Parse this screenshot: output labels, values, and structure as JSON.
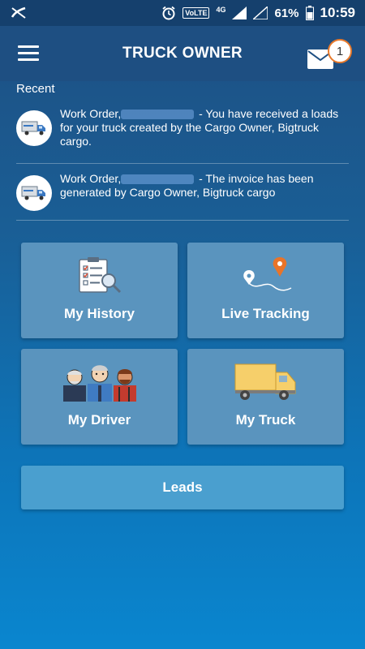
{
  "status_bar": {
    "volte": "VoLTE",
    "network": "4G",
    "battery": "61%",
    "time": "10:59"
  },
  "appbar": {
    "title": "TRUCK OWNER",
    "mail_badge_count": "1"
  },
  "recent": {
    "label": "Recent",
    "items": [
      {
        "prefix": "Work Order,",
        "text": " - You have received a loads for your truck created by the Cargo Owner, Bigtruck cargo."
      },
      {
        "prefix": "Work Order,",
        "text": " - The invoice has been generated by Cargo Owner, Bigtruck cargo"
      }
    ]
  },
  "tiles": [
    {
      "label": "My History",
      "icon": "clipboard-search-icon"
    },
    {
      "label": "Live Tracking",
      "icon": "location-route-icon"
    },
    {
      "label": "My Driver",
      "icon": "drivers-group-icon"
    },
    {
      "label": "My Truck",
      "icon": "truck-icon"
    }
  ],
  "leads_button": {
    "label": "Leads"
  },
  "colors": {
    "appbar": "#1e4f82",
    "tile": "#5a94be",
    "leads": "#4a9fcf",
    "badge_border": "#e87a2c"
  }
}
